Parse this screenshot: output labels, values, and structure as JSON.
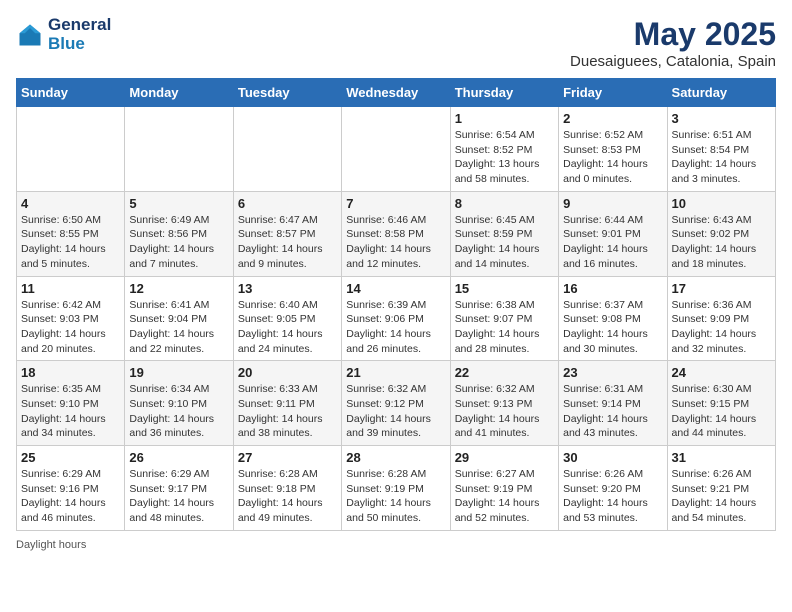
{
  "header": {
    "logo_line1": "General",
    "logo_line2": "Blue",
    "month": "May 2025",
    "location": "Duesaiguees, Catalonia, Spain"
  },
  "days_of_week": [
    "Sunday",
    "Monday",
    "Tuesday",
    "Wednesday",
    "Thursday",
    "Friday",
    "Saturday"
  ],
  "weeks": [
    [
      {
        "day": "",
        "info": ""
      },
      {
        "day": "",
        "info": ""
      },
      {
        "day": "",
        "info": ""
      },
      {
        "day": "",
        "info": ""
      },
      {
        "day": "1",
        "info": "Sunrise: 6:54 AM\nSunset: 8:52 PM\nDaylight: 13 hours\nand 58 minutes."
      },
      {
        "day": "2",
        "info": "Sunrise: 6:52 AM\nSunset: 8:53 PM\nDaylight: 14 hours\nand 0 minutes."
      },
      {
        "day": "3",
        "info": "Sunrise: 6:51 AM\nSunset: 8:54 PM\nDaylight: 14 hours\nand 3 minutes."
      }
    ],
    [
      {
        "day": "4",
        "info": "Sunrise: 6:50 AM\nSunset: 8:55 PM\nDaylight: 14 hours\nand 5 minutes."
      },
      {
        "day": "5",
        "info": "Sunrise: 6:49 AM\nSunset: 8:56 PM\nDaylight: 14 hours\nand 7 minutes."
      },
      {
        "day": "6",
        "info": "Sunrise: 6:47 AM\nSunset: 8:57 PM\nDaylight: 14 hours\nand 9 minutes."
      },
      {
        "day": "7",
        "info": "Sunrise: 6:46 AM\nSunset: 8:58 PM\nDaylight: 14 hours\nand 12 minutes."
      },
      {
        "day": "8",
        "info": "Sunrise: 6:45 AM\nSunset: 8:59 PM\nDaylight: 14 hours\nand 14 minutes."
      },
      {
        "day": "9",
        "info": "Sunrise: 6:44 AM\nSunset: 9:01 PM\nDaylight: 14 hours\nand 16 minutes."
      },
      {
        "day": "10",
        "info": "Sunrise: 6:43 AM\nSunset: 9:02 PM\nDaylight: 14 hours\nand 18 minutes."
      }
    ],
    [
      {
        "day": "11",
        "info": "Sunrise: 6:42 AM\nSunset: 9:03 PM\nDaylight: 14 hours\nand 20 minutes."
      },
      {
        "day": "12",
        "info": "Sunrise: 6:41 AM\nSunset: 9:04 PM\nDaylight: 14 hours\nand 22 minutes."
      },
      {
        "day": "13",
        "info": "Sunrise: 6:40 AM\nSunset: 9:05 PM\nDaylight: 14 hours\nand 24 minutes."
      },
      {
        "day": "14",
        "info": "Sunrise: 6:39 AM\nSunset: 9:06 PM\nDaylight: 14 hours\nand 26 minutes."
      },
      {
        "day": "15",
        "info": "Sunrise: 6:38 AM\nSunset: 9:07 PM\nDaylight: 14 hours\nand 28 minutes."
      },
      {
        "day": "16",
        "info": "Sunrise: 6:37 AM\nSunset: 9:08 PM\nDaylight: 14 hours\nand 30 minutes."
      },
      {
        "day": "17",
        "info": "Sunrise: 6:36 AM\nSunset: 9:09 PM\nDaylight: 14 hours\nand 32 minutes."
      }
    ],
    [
      {
        "day": "18",
        "info": "Sunrise: 6:35 AM\nSunset: 9:10 PM\nDaylight: 14 hours\nand 34 minutes."
      },
      {
        "day": "19",
        "info": "Sunrise: 6:34 AM\nSunset: 9:10 PM\nDaylight: 14 hours\nand 36 minutes."
      },
      {
        "day": "20",
        "info": "Sunrise: 6:33 AM\nSunset: 9:11 PM\nDaylight: 14 hours\nand 38 minutes."
      },
      {
        "day": "21",
        "info": "Sunrise: 6:32 AM\nSunset: 9:12 PM\nDaylight: 14 hours\nand 39 minutes."
      },
      {
        "day": "22",
        "info": "Sunrise: 6:32 AM\nSunset: 9:13 PM\nDaylight: 14 hours\nand 41 minutes."
      },
      {
        "day": "23",
        "info": "Sunrise: 6:31 AM\nSunset: 9:14 PM\nDaylight: 14 hours\nand 43 minutes."
      },
      {
        "day": "24",
        "info": "Sunrise: 6:30 AM\nSunset: 9:15 PM\nDaylight: 14 hours\nand 44 minutes."
      }
    ],
    [
      {
        "day": "25",
        "info": "Sunrise: 6:29 AM\nSunset: 9:16 PM\nDaylight: 14 hours\nand 46 minutes."
      },
      {
        "day": "26",
        "info": "Sunrise: 6:29 AM\nSunset: 9:17 PM\nDaylight: 14 hours\nand 48 minutes."
      },
      {
        "day": "27",
        "info": "Sunrise: 6:28 AM\nSunset: 9:18 PM\nDaylight: 14 hours\nand 49 minutes."
      },
      {
        "day": "28",
        "info": "Sunrise: 6:28 AM\nSunset: 9:19 PM\nDaylight: 14 hours\nand 50 minutes."
      },
      {
        "day": "29",
        "info": "Sunrise: 6:27 AM\nSunset: 9:19 PM\nDaylight: 14 hours\nand 52 minutes."
      },
      {
        "day": "30",
        "info": "Sunrise: 6:26 AM\nSunset: 9:20 PM\nDaylight: 14 hours\nand 53 minutes."
      },
      {
        "day": "31",
        "info": "Sunrise: 6:26 AM\nSunset: 9:21 PM\nDaylight: 14 hours\nand 54 minutes."
      }
    ]
  ],
  "footer": {
    "note": "Daylight hours"
  }
}
